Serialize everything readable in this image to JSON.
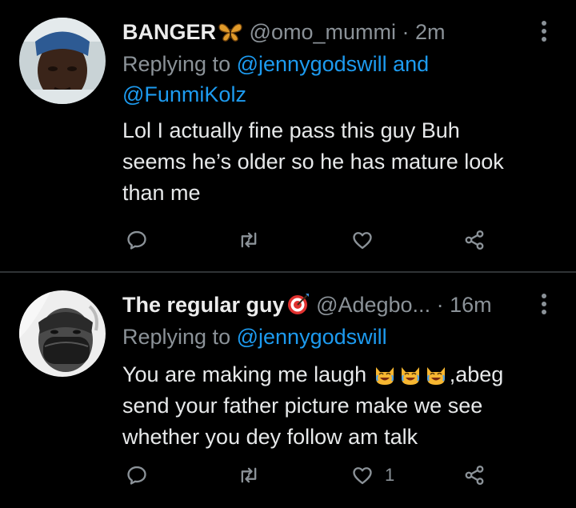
{
  "tweets": [
    {
      "name": "BANGER",
      "badge_icon": "butterfly-icon",
      "handle": "@omo_mummi",
      "separator": "·",
      "time": "2m",
      "replying_prefix": "Replying to",
      "mention_1": "@jennygodswill",
      "and_word": "and",
      "mention_2": "@FunmiKolz",
      "text_lines": [
        "Lol I actually fine pass this guy Buh",
        "seems he’s older so he has mature look",
        "than me"
      ],
      "like_count": ""
    },
    {
      "name": "The regular guy",
      "badge_icon": "target-icon",
      "handle": "@Adegbo...",
      "separator": "·",
      "time": "16m",
      "replying_prefix": "Replying to",
      "mention_1": "@jennygodswill",
      "text_line1_a": "You are making me laugh",
      "text_line1_b": ",abeg",
      "emoji_icon": "laughing-cat-emoji-icon",
      "text_lines_rest": [
        "send your father picture make we see",
        "whether you dey follow am talk"
      ],
      "like_count": "1"
    }
  ],
  "colors": {
    "background": "#000000",
    "text": "#e7e9ea",
    "muted": "#8b9298",
    "accent": "#1d9bf0"
  }
}
